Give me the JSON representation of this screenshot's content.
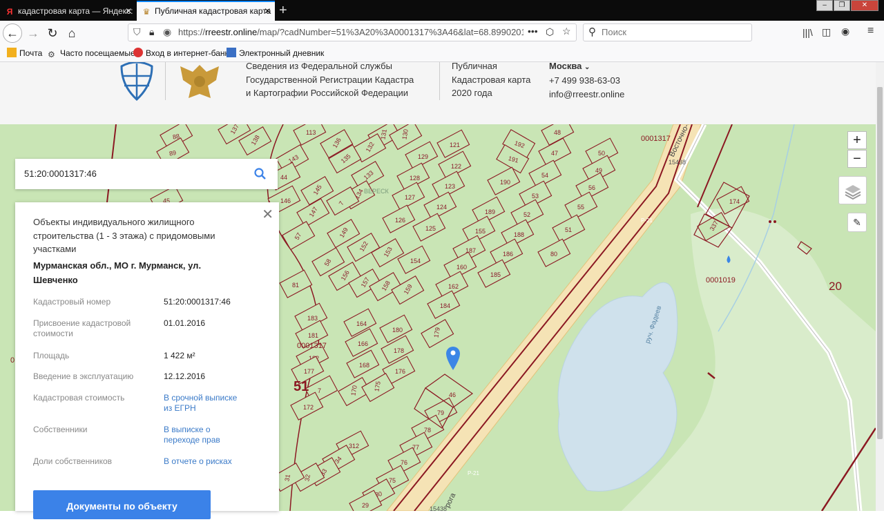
{
  "browser": {
    "tabs": [
      {
        "label": "кадастровая карта — Яндекс:"
      },
      {
        "label": "Публичная кадастровая карта"
      }
    ],
    "url_prefix": "https://",
    "url_domain": "rreestr.online",
    "url_rest": "/map/?cadNumber=51%3A20%3A0001317%3A46&lat=68.8990201799",
    "search_placeholder": "Поиск",
    "bookmarks": [
      "Почта",
      "Часто посещаемые",
      "Вход в интернет-банк",
      "Электронный дневник"
    ]
  },
  "site": {
    "line1": "Сведения из Федеральной службы",
    "line2": "Государственной Регистрации Кадастра",
    "line3": "и Картографии Российской Федерации",
    "pub1": "Публичная",
    "pub2": "Кадастровая карта",
    "pub3": "2020 года",
    "city": "Москва",
    "phone": "+7 499 938-63-03",
    "email": "info@rreestr.online"
  },
  "search": {
    "value": "51:20:0001317:46"
  },
  "info": {
    "title": "Объекты индивидуального жилищного строительства (1 - 3 этажа) с придомовыми участками",
    "address": "Мурманская обл., МО г. Мурманск, ул. Шевченко",
    "rows": [
      {
        "label": "Кадастровый номер",
        "value": "51:20:0001317:46"
      },
      {
        "label": "Присвоение кадастровой стоимости",
        "value": "01.01.2016"
      },
      {
        "label": "Площадь",
        "value": "1 422 м²"
      },
      {
        "label": "Введение в эксплуатацию",
        "value": "12.12.2016"
      },
      {
        "label": "Кадастровая стоимость",
        "value": "В срочной выписке из ЕГРН"
      },
      {
        "label": "Собственники",
        "value": "В выписке о переходе прав"
      },
      {
        "label": "Доли собственников",
        "value": "В отчете о рисках"
      }
    ],
    "button": "Документы по объекту"
  },
  "map": {
    "zoom_in": "+",
    "zoom_out": "−",
    "labels": {
      "quarter_top": "0001317",
      "road": "Восточно-С",
      "road_num": "15438",
      "quarter_mid": "0001317",
      "big_51": "51",
      "quarter_right": "0001019",
      "big_20": "20",
      "stream": "руч. Фадеев",
      "r21a": "Р-21",
      "r21b": "Р-21",
      "road_bottom_num": "15438",
      "road_bottom": "рога",
      "vereskl": "ВЕРЕСК",
      "edge_0": "0",
      "marker": "46"
    },
    "plots": [
      "88",
      "89",
      "137",
      "138",
      "113",
      "131",
      "130",
      "136",
      "132",
      "121",
      "48",
      "192",
      "47",
      "50",
      "143",
      "135",
      "133",
      "129",
      "122",
      "191",
      "54",
      "49",
      "44",
      "145",
      "134",
      "128",
      "123",
      "190",
      "53",
      "56",
      "146",
      "7",
      "127",
      "124",
      "189",
      "52",
      "55",
      "45",
      "147",
      "126",
      "125",
      "188",
      "51",
      "57",
      "149",
      "152",
      "153",
      "154",
      "155",
      "187",
      "186",
      "80",
      "58",
      "156",
      "157",
      "158",
      "159",
      "160",
      "185",
      "81",
      "162",
      "184",
      "183",
      "164",
      "180",
      "181",
      "166",
      "178",
      "179",
      "182",
      "168",
      "176",
      "177",
      "170",
      "175",
      "7",
      "172",
      "174",
      "337",
      "312",
      "79",
      "34",
      "78",
      "33",
      "77",
      "32",
      "76",
      "31",
      "75",
      "30",
      "29",
      "28"
    ]
  }
}
